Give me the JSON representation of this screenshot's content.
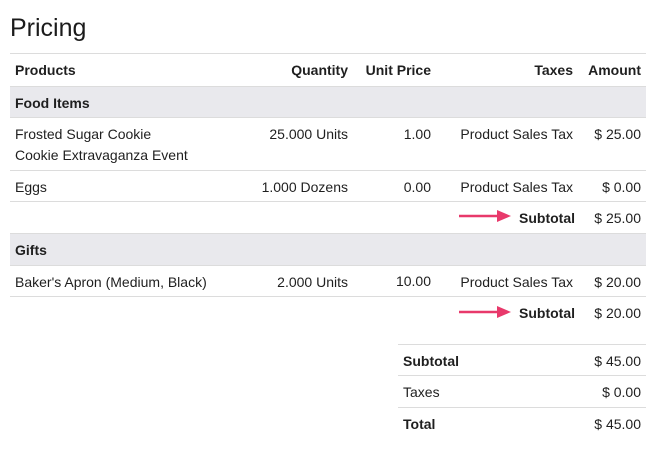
{
  "section_title": "Pricing",
  "columns": {
    "products": "Products",
    "quantity": "Quantity",
    "unit_price": "Unit Price",
    "taxes": "Taxes",
    "amount": "Amount"
  },
  "sections": [
    {
      "name": "Food Items",
      "rows": [
        {
          "product_line1": "Frosted Sugar Cookie",
          "product_line2": "Cookie Extravaganza Event",
          "quantity": "25.000 Units",
          "unit_price": "1.00",
          "taxes": "Product Sales Tax",
          "amount": "$ 25.00"
        },
        {
          "product_line1": "Eggs",
          "quantity": "1.000 Dozens",
          "unit_price": "0.00",
          "taxes": "Product Sales Tax",
          "amount": "$ 0.00"
        }
      ],
      "subtotal_label": "Subtotal",
      "subtotal_value": "$ 25.00"
    },
    {
      "name": "Gifts",
      "rows": [
        {
          "product_line1": "Baker's Apron (Medium, Black)",
          "quantity": "2.000 Units",
          "unit_price": "10.00",
          "taxes": "Product Sales Tax",
          "amount": "$ 20.00"
        }
      ],
      "subtotal_label": "Subtotal",
      "subtotal_value": "$ 20.00"
    }
  ],
  "summary": {
    "subtotal_label": "Subtotal",
    "subtotal_value": "$ 45.00",
    "taxes_label": "Taxes",
    "taxes_value": "$ 0.00",
    "total_label": "Total",
    "total_value": "$ 45.00"
  },
  "colors": {
    "arrow": "#e8396b",
    "section_band": "#e9e9ed"
  },
  "icons": {
    "subtotal_pointer": "arrow-right-icon"
  }
}
